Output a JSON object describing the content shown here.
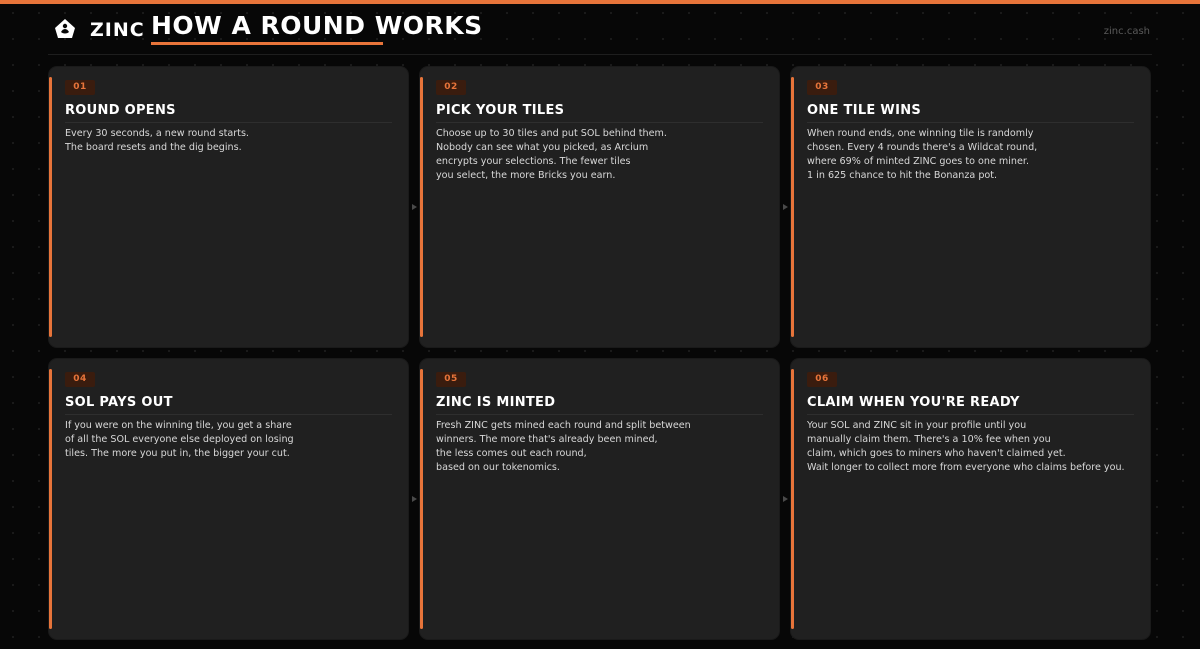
{
  "brand": "ZINC",
  "title": "HOW A ROUND WORKS",
  "site_url": "zinc.cash",
  "logo_icon": "zinc-logo-icon",
  "accent_color": "#e7743a",
  "cards": [
    {
      "number": "01",
      "title": "ROUND OPENS",
      "lines": [
        "Every 30 seconds, a new round starts.",
        "The board resets and the dig begins."
      ]
    },
    {
      "number": "02",
      "title": "PICK YOUR TILES",
      "lines": [
        "Choose up to 30 tiles and put SOL behind them.",
        "Nobody can see what you picked, as Arcium",
        "encrypts your selections. The fewer tiles",
        "you select, the more Bricks you earn."
      ]
    },
    {
      "number": "03",
      "title": "ONE TILE WINS",
      "lines": [
        "When round ends, one winning tile is randomly",
        "chosen. Every 4 rounds there's a Wildcat round,",
        "where 69% of minted ZINC goes to one miner.",
        "1 in 625 chance to hit the Bonanza pot."
      ]
    },
    {
      "number": "04",
      "title": "SOL PAYS OUT",
      "lines": [
        "If you were on the winning tile, you get a share",
        "of all the SOL everyone else deployed on losing",
        "tiles. The more you put in, the bigger your cut."
      ]
    },
    {
      "number": "05",
      "title": "ZINC IS MINTED",
      "lines": [
        "Fresh ZINC gets mined each round and split between",
        "winners. The more that's already been mined,",
        "the less comes out each round,",
        "based on our tokenomics."
      ]
    },
    {
      "number": "06",
      "title": "CLAIM WHEN YOU'RE READY",
      "lines": [
        "Your SOL and ZINC sit in your profile until you",
        "manually claim them. There's a 10% fee when you",
        "claim, which goes to miners who haven't claimed yet.",
        "Wait longer to collect more from everyone who claims before you."
      ]
    }
  ]
}
